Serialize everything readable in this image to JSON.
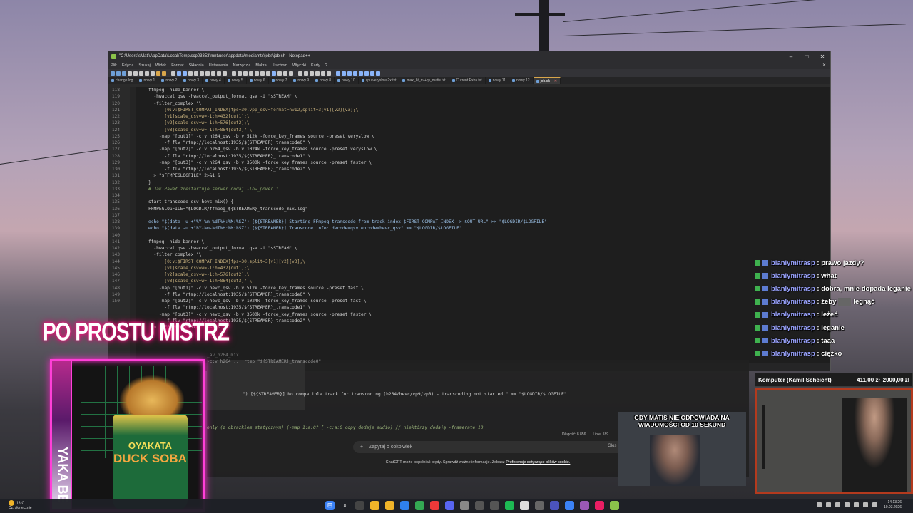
{
  "window": {
    "title": "\"C:\\Users\\sMati\\AppData\\Local\\Temp\\scp03353\\mnt\\user\\appdata\\mediamtx\\jobs\\job.sh - Notepad++",
    "menu": [
      "Plik",
      "Edycja",
      "Szukaj",
      "Widok",
      "Format",
      "Składnia",
      "Ustawienia",
      "Narzędzia",
      "Makra",
      "Uruchom",
      "Wtyczki",
      "Karty",
      "?"
    ],
    "tabs": [
      "change.log",
      "nowy 1",
      "nowy 2",
      "nowy 3",
      "nowy 4",
      "nowy 5",
      "nowy 6",
      "nowy 7",
      "nowy 9",
      "nowy 8",
      "nowy 10",
      "cpu-veryslow-2x.txt",
      "max_6t_nv+qs_matis.txt",
      "Current Exira.txt",
      "nowy 11",
      "nowy 12",
      "job.sh"
    ],
    "active_tab": "job.sh",
    "status_length": "Długość: 8 856",
    "status_lines": "Linie: 189"
  },
  "code_lines": [
    {
      "n": "118",
      "t": "ffmpeg -hide_banner \\",
      "k": "cmd"
    },
    {
      "n": "119",
      "t": "  -hwaccel qsv -hwaccel_output_format qsv -i \"$STREAM\" \\",
      "k": "cmd"
    },
    {
      "n": "120",
      "t": "  -filter_complex \"\\",
      "k": "cmd"
    },
    {
      "n": "121",
      "t": "      [0:v:$FIRST_COMPAT_INDEX]fps=30,vpp_qsv=format=nv12,split=3[v1][v2][v3];\\",
      "k": "str"
    },
    {
      "n": "122",
      "t": "      [v1]scale_qsv=w=-1:h=432[out1];\\",
      "k": "str"
    },
    {
      "n": "123",
      "t": "      [v2]scale_qsv=w=-1:h=576[out2];\\",
      "k": "str"
    },
    {
      "n": "124",
      "t": "      [v3]scale_qsv=w=-1:h=864[out3]\" \\",
      "k": "str"
    },
    {
      "n": "125",
      "t": "    -map \"[out1]\" -c:v h264_qsv -b:v 512k -force_key_frames source -preset veryslow \\",
      "k": "cmd"
    },
    {
      "n": "126",
      "t": "      -f flv \"rtmp://localhost:1935/${STREAMER}_transcode0\" \\",
      "k": "cmd"
    },
    {
      "n": "127",
      "t": "    -map \"[out2]\" -c:v h264_qsv -b:v 1024k -force_key_frames source -preset veryslow \\",
      "k": "cmd"
    },
    {
      "n": "128",
      "t": "      -f flv \"rtmp://localhost:1935/${STREAMER}_transcode1\" \\",
      "k": "cmd"
    },
    {
      "n": "129",
      "t": "    -map \"[out3]\" -c:v h264_qsv -b:v 3500k -force_key_frames source -preset faster \\",
      "k": "cmd"
    },
    {
      "n": "130",
      "t": "      -f flv \"rtmp://localhost:1935/${STREAMER}_transcode2\" \\",
      "k": "cmd"
    },
    {
      "n": "131",
      "t": "  > \"$FFMPEGLOGFILE\" 2>&1 &",
      "k": "cmd"
    },
    {
      "n": "132",
      "t": "}",
      "k": "cmd"
    },
    {
      "n": "133",
      "t": "# Jak Paweł zrestartuje serwer dodaj -low_power 1",
      "k": "cmt"
    },
    {
      "n": "134",
      "t": "",
      "k": "cmd"
    },
    {
      "n": "135",
      "t": "start_transcode_qsv_hevc_mix() {",
      "k": "cmd"
    },
    {
      "n": "136",
      "t": "FFMPEGLOGFILE=\"$LOGDIR/ffmpeg_${STREAMER}_transcode_mix.log\"",
      "k": "cmd"
    },
    {
      "n": "137",
      "t": "",
      "k": "cmd"
    },
    {
      "n": "138",
      "t": "echo \"$(date -u +\"%Y-%m-%dT%H:%M:%SZ\") [${STREAMER}] Starting FFmpeg transcode from track index $FIRST_COMPAT_INDEX -> $OUT_URL\" >> \"$LOGDIR/$LOGFILE\"",
      "k": "kw"
    },
    {
      "n": "139",
      "t": "echo \"$(date -u +\"%Y-%m-%dT%H:%M:%SZ\") [${STREAMER}] Transcode info: decode=qsv encode=hevc_qsv\" >> \"$LOGDIR/$LOGFILE\"",
      "k": "kw"
    },
    {
      "n": "140",
      "t": "",
      "k": "cmd"
    },
    {
      "n": "141",
      "t": "ffmpeg -hide_banner \\",
      "k": "cmd"
    },
    {
      "n": "142",
      "t": "  -hwaccel qsv -hwaccel_output_format qsv -i \"$STREAM\" \\",
      "k": "cmd"
    },
    {
      "n": "143",
      "t": "  -filter_complex \"\\",
      "k": "cmd"
    },
    {
      "n": "144",
      "t": "      [0:v:$FIRST_COMPAT_INDEX]fps=30,split=3[v1][v2][v3];\\",
      "k": "str"
    },
    {
      "n": "145",
      "t": "      [v1]scale_qsv=w=-1:h=432[out1];\\",
      "k": "str"
    },
    {
      "n": "146",
      "t": "      [v2]scale_qsv=w=-1:h=576[out2];\\",
      "k": "str"
    },
    {
      "n": "147",
      "t": "      [v3]scale_qsv=w=-1:h=864[out3]\" \\",
      "k": "str"
    },
    {
      "n": "148",
      "t": "    -map \"[out1]\" -c:v hevc_qsv -b:v 512k -force_key_frames source -preset fast \\",
      "k": "cmd"
    },
    {
      "n": "149",
      "t": "      -f flv \"rtmp://localhost:1935/${STREAMER}_transcode0\" \\",
      "k": "cmd"
    },
    {
      "n": "150",
      "t": "    -map \"[out2]\" -c:v hevc_qsv -b:v 1024k -force_key_frames source -preset fast \\",
      "k": "cmd"
    },
    {
      "n": "",
      "t": "      -f flv \"rtmp://localhost:1935/${STREAMER}_transcode1\" \\",
      "k": "cmd"
    },
    {
      "n": "",
      "t": "    -map \"[out3]\" -c:v hevc_qsv -b:v 3500k -force_key_frames source -preset faster \\",
      "k": "cmd"
    },
    {
      "n": "",
      "t": "      -f flv \"rtmp://localhost:1935/${STREAMER}_transcode2\" \\",
      "k": "cmd"
    },
    {
      "n": "",
      "t": "  > \"$FFMPEGLOGFILE\" 2>&1 &",
      "k": "cmd"
    }
  ],
  "chat": {
    "messages": [
      {
        "user": "blanlymitrasp",
        "text": "prawo jazdy?"
      },
      {
        "user": "blanlymitrasp",
        "text": "what"
      },
      {
        "user": "blanlymitrasp",
        "text": "dobra, mnie dopada leganie"
      },
      {
        "user": "blanlymitrasp",
        "text": "żeby",
        "text2": "legnąć"
      },
      {
        "user": "blanlymitrasp",
        "text": "leżeć"
      },
      {
        "user": "blanlymitrasp",
        "text": "leganie"
      },
      {
        "user": "blanlymitrasp",
        "text": "taaa"
      },
      {
        "user": "blanlymitrasp",
        "text": "ciężko"
      }
    ]
  },
  "promo": {
    "title": "PO PROSTU MISTRZ",
    "brand": "OYAKATA",
    "product": "DUCK SOBA",
    "side_text": "YAKA BE"
  },
  "chatgpt": {
    "code_fragments": [
      "_av_h264_mix;",
      "-c:v h264 ... rtmp \"${STREAMER}_transcode0\"",
      "\") [${STREAMER}] No compatible track for transcoding (h264/hevc/vp9/vp8) - transcoding not started.\" >> \"$LOGDIR/$LOGFILE\"",
      "only (z obrazkiem statycznym) (-map 1:a:0? [ -c:a:0 copy dodaje audio) // niektórzy dodają -framerate 10"
    ],
    "input_placeholder": "Zapytaj o cokolwiek",
    "input_right": "Głos",
    "disclaimer": "ChatGPT może popełniać błędy. Sprawdź ważne informacje. Zobacz",
    "disclaimer_link": "Preferencje dotyczące plików cookie."
  },
  "meme": {
    "caption": "GDY MATIS NIE ODPOWIADA NA WIADOMOŚCI OD 10 SEKUND"
  },
  "donation": {
    "label": "Komputer (Kamil Scheicht)",
    "current": "411,00 zł",
    "goal": "2000,00 zł",
    "progress": 0.2055
  },
  "taskbar": {
    "weather_temp": "18°C",
    "weather_desc": "Cz. słonecznie",
    "time": "14:13:26",
    "date": "10.03.2026",
    "icons": [
      "windows-start-icon",
      "search-icon",
      "task-view-icon",
      "file-explorer-icon",
      "files-icon",
      "vscode-icon",
      "chrome-icon",
      "vivaldi-icon",
      "discord-icon",
      "app-icon",
      "terminal-icon",
      "obs-icon",
      "spotify-icon",
      "github-icon",
      "settings-icon",
      "teams-icon",
      "notepad-icon",
      "app2-icon",
      "app3-icon",
      "notepadpp-icon"
    ]
  },
  "colors": {
    "neon_pink": "#ff3fd8",
    "chat_user": "#9aa3ff",
    "code_string": "#c9b27e",
    "code_comment": "#8aa66a"
  }
}
